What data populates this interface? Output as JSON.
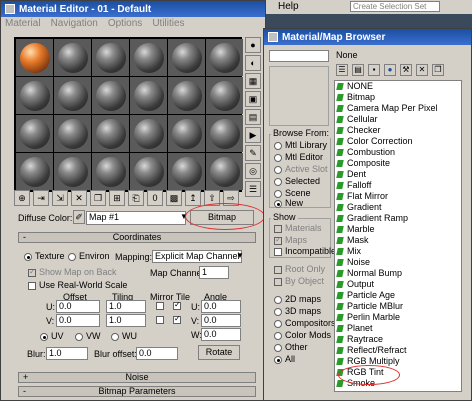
{
  "background_app": {
    "menu_help": "Help",
    "selection_set_placeholder": "Create Selection Set"
  },
  "material_editor": {
    "title": "Material Editor - 01 - Default",
    "menu": [
      "Material",
      "Navigation",
      "Options",
      "Utilities"
    ],
    "diffuse_color_label": "Diffuse Color:",
    "map_name": "Map #1",
    "map_type_button": "Bitmap",
    "coordinates_rollout": "Coordinates",
    "texture_label": "Texture",
    "environ_label": "Environ",
    "mapping_label": "Mapping:",
    "mapping_value": "Explicit Map Channel",
    "show_map_on_back": "Show Map on Back",
    "map_channel_label": "Map Channel:",
    "map_channel_value": "1",
    "use_real_world_scale": "Use Real-World Scale",
    "offset_label": "Offset",
    "tiling_label": "Tiling",
    "mirror_tile_label": "Mirror Tile",
    "angle_label": "Angle",
    "u_label": "U:",
    "v_label": "V:",
    "w_label": "W:",
    "u_offset": "0.0",
    "v_offset": "0.0",
    "u_tiling": "1.0",
    "v_tiling": "1.0",
    "u_angle": "0.0",
    "v_angle": "0.0",
    "w_angle": "0.0",
    "uv_label": "UV",
    "vw_label": "VW",
    "wu_label": "WU",
    "blur_label": "Blur:",
    "blur_value": "1.0",
    "blur_offset_label": "Blur offset:",
    "blur_offset_value": "0.0",
    "rotate_button": "Rotate",
    "noise_rollout": "Noise",
    "bitmap_params_rollout": "Bitmap Parameters",
    "plus": "+",
    "minus": "-"
  },
  "browser": {
    "title": "Material/Map Browser",
    "name_value": "None",
    "browse_from_title": "Browse From:",
    "browse_from": [
      {
        "label": "Mtl Library",
        "selected": false,
        "disabled": false
      },
      {
        "label": "Mtl Editor",
        "selected": false,
        "disabled": false
      },
      {
        "label": "Active Slot",
        "selected": false,
        "disabled": true
      },
      {
        "label": "Selected",
        "selected": false,
        "disabled": false
      },
      {
        "label": "Scene",
        "selected": false,
        "disabled": false
      },
      {
        "label": "New",
        "selected": true,
        "disabled": false
      }
    ],
    "show_title": "Show",
    "show": [
      {
        "label": "Materials",
        "checked": false,
        "disabled": true
      },
      {
        "label": "Maps",
        "checked": true,
        "disabled": true
      },
      {
        "label": "Incompatible",
        "checked": false,
        "disabled": false
      }
    ],
    "extra_checks": [
      {
        "label": "Root Only",
        "disabled": true
      },
      {
        "label": "By Object",
        "disabled": true
      }
    ],
    "categories": [
      {
        "label": "2D maps",
        "selected": false
      },
      {
        "label": "3D maps",
        "selected": false
      },
      {
        "label": "Compositors",
        "selected": false
      },
      {
        "label": "Color Mods",
        "selected": false
      },
      {
        "label": "Other",
        "selected": false
      },
      {
        "label": "All",
        "selected": true
      }
    ],
    "maps": [
      "NONE",
      "Bitmap",
      "Camera Map Per Pixel",
      "Cellular",
      "Checker",
      "Color Correction",
      "Combustion",
      "Composite",
      "Dent",
      "Falloff",
      "Flat Mirror",
      "Gradient",
      "Gradient Ramp",
      "Marble",
      "Mask",
      "Mix",
      "Noise",
      "Normal Bump",
      "Output",
      "Particle Age",
      "Particle MBlur",
      "Perlin Marble",
      "Planet",
      "Raytrace",
      "Reflect/Refract",
      "RGB Multiply",
      "RGB Tint",
      "Smoke"
    ]
  },
  "colors": {
    "annotation": "#e03030",
    "title_bar": "#1c4fa0",
    "map_icon": "#2a9a2a"
  }
}
